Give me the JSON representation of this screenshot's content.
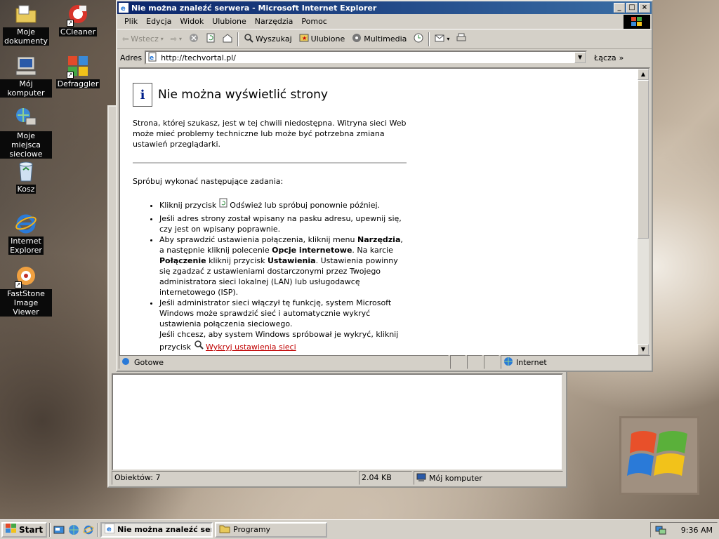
{
  "desktop": {
    "icons": [
      {
        "label_1": "Moje",
        "label_2": "dokumenty"
      },
      {
        "label_1": "CCleaner",
        "label_2": ""
      },
      {
        "label_1": "Mój komputer",
        "label_2": ""
      },
      {
        "label_1": "Defraggler",
        "label_2": ""
      },
      {
        "label_1": "Moje miejsca",
        "label_2": "sieciowe"
      },
      {
        "label_1": "Kosz",
        "label_2": ""
      },
      {
        "label_1": "Internet",
        "label_2": "Explorer"
      },
      {
        "label_1": "FastStone",
        "label_2": "Image Viewer"
      }
    ]
  },
  "explorer": {
    "status": {
      "objects": "Obiektów: 7",
      "size": "2.04 KB",
      "location": "Mój komputer"
    }
  },
  "ie": {
    "title": "Nie można znaleźć serwera - Microsoft Internet Explorer",
    "menu": [
      "Plik",
      "Edycja",
      "Widok",
      "Ulubione",
      "Narzędzia",
      "Pomoc"
    ],
    "toolbar": {
      "back": "Wstecz",
      "search": "Wyszukaj",
      "favorites": "Ulubione",
      "media": "Multimedia"
    },
    "address": {
      "label": "Adres",
      "value": "http://techvortal.pl/",
      "go": "Łącza"
    },
    "page": {
      "heading": "Nie można wyświetlić strony",
      "intro": "Strona, której szukasz, jest w tej chwili niedostępna. Witryna sieci Web może mieć problemy techniczne lub może być potrzebna zmiana ustawień przeglądarki.",
      "try": "Spróbuj wykonać następujące zadania:",
      "b1_a": "Kliknij przycisk",
      "b1_b": "Odśwież lub spróbuj ponownie później.",
      "b2": "Jeśli adres strony został wpisany na pasku adresu, upewnij się, czy jest on wpisany poprawnie.",
      "b3_a": "Aby sprawdzić ustawienia połączenia, kliknij menu ",
      "b3_b": "Narzędzia",
      "b3_c": ", a następnie kliknij polecenie ",
      "b3_d": "Opcje internetowe",
      "b3_e": ". Na karcie ",
      "b3_f": "Połączenie",
      "b3_g": " kliknij przycisk ",
      "b3_h": "Ustawienia",
      "b3_i": ". Ustawienia powinny się zgadzać z ustawieniami dostarczonymi przez Twojego administratora sieci lokalnej (LAN) lub usługodawcę internetowego (ISP).",
      "b4_a": "Jeśli administrator sieci włączył tę funkcję, system Microsoft Windows może sprawdzić sieć i automatycznie wykryć ustawienia połączenia sieciowego.",
      "b4_b": "Jeśli chcesz, aby system Windows spróbował je wykryć, kliknij przycisk",
      "b4_link": "Wykryj ustawienia sieci"
    },
    "status": {
      "text": "Gotowe",
      "zone": "Internet"
    }
  },
  "taskbar": {
    "start": "Start",
    "tasks": [
      "Nie można znaleźć ser...",
      "Programy"
    ],
    "clock": "9:36 AM"
  }
}
